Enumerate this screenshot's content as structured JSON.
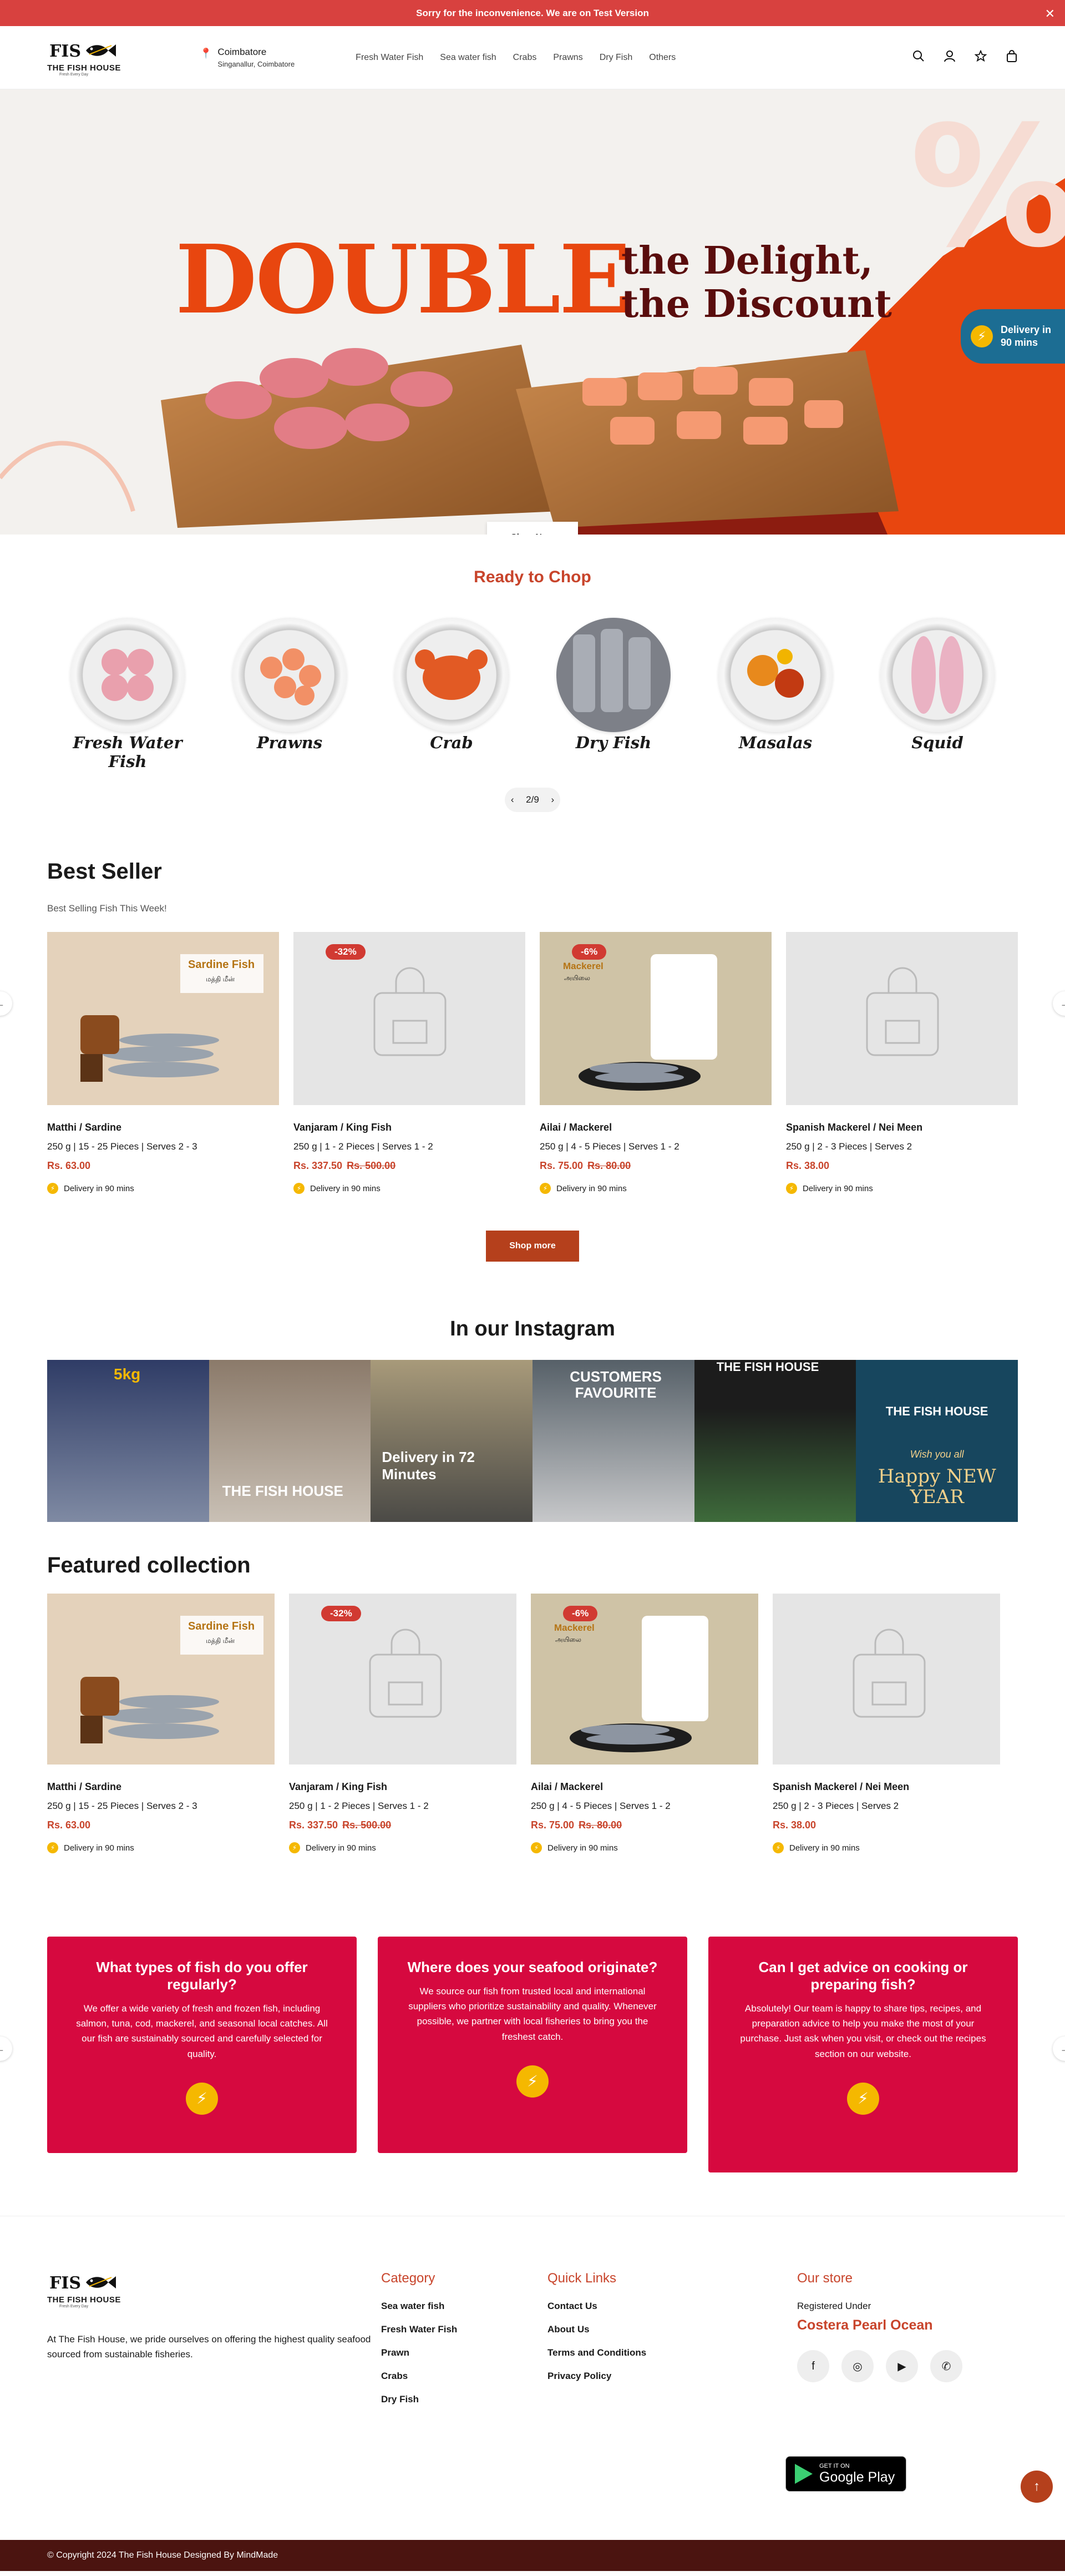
{
  "announcement": {
    "text": "Sorry for the inconvenience. We are on Test Version",
    "close": "✕"
  },
  "header": {
    "logo_brand": "THE FISH HOUSE",
    "logo_tag": "Fresh Every Day",
    "location_city": "Coimbatore",
    "location_area": "Singanallur, Coimbatore",
    "nav": [
      "Fresh Water Fish",
      "Sea water fish",
      "Crabs",
      "Prawns",
      "Dry Fish",
      "Others"
    ]
  },
  "hero": {
    "title": "DOUBLE",
    "subtitle_line1": "the Delight,",
    "subtitle_line2": "the Discount",
    "shop_now": "Shop Now",
    "delivery_line1": "Delivery in",
    "delivery_line2": "90 mins"
  },
  "chop": {
    "title": "Ready to Chop",
    "categories": [
      "Fresh Water Fish",
      "Prawns",
      "Crab",
      "Dry Fish",
      "Masalas",
      "Squid"
    ],
    "pager": "2/9"
  },
  "best_seller": {
    "title": "Best Seller",
    "subtitle": "Best Selling Fish This Week!",
    "shop_more": "Shop more",
    "products": [
      {
        "name": "Matthi / Sardine",
        "meta": "250 g | 15 - 25 Pieces | Serves 2 - 3",
        "price": "Rs. 63.00",
        "old": "",
        "badge": "",
        "img_label": "Sardine Fish",
        "img_label2": "மத்தி மீன்",
        "delivery": "Delivery in 90 mins"
      },
      {
        "name": "Vanjaram / King Fish",
        "meta": "250 g | 1 - 2 Pieces | Serves 1 - 2",
        "price": "Rs. 337.50",
        "old": "Rs. 500.00",
        "badge": "-32%",
        "img_label": "",
        "img_label2": "",
        "delivery": "Delivery in 90 mins"
      },
      {
        "name": "Ailai / Mackerel",
        "meta": "250 g | 4 - 5 Pieces | Serves 1 - 2",
        "price": "Rs. 75.00",
        "old": "Rs. 80.00",
        "badge": "-6%",
        "img_label": "Mackerel",
        "img_label2": "அயிலை",
        "delivery": "Delivery in 90 mins"
      },
      {
        "name": "Spanish Mackerel / Nei Meen",
        "meta": "250 g | 2 - 3 Pieces | Serves 2",
        "price": "Rs. 38.00",
        "old": "",
        "badge": "",
        "img_label": "",
        "img_label2": "",
        "delivery": "Delivery in 90 mins"
      }
    ]
  },
  "instagram": {
    "title": "In our Instagram",
    "tiles": [
      {
        "caption": "5kg"
      },
      {
        "caption": "THE FISH HOUSE"
      },
      {
        "caption": "Delivery in 72 Minutes"
      },
      {
        "caption": "CUSTOMERS FAVOURITE"
      },
      {
        "caption": "THE FISH HOUSE"
      },
      {
        "caption": "THE FISH HOUSE",
        "caption2": "Wish you all",
        "caption3": "Happy NEW YEAR"
      }
    ]
  },
  "featured": {
    "title": "Featured collection",
    "products": [
      {
        "name": "Matthi / Sardine",
        "meta": "250 g | 15 - 25 Pieces | Serves 2 - 3",
        "price": "Rs. 63.00",
        "old": "",
        "badge": "",
        "img_label": "Sardine Fish",
        "img_label2": "மத்தி மீன்",
        "delivery": "Delivery in 90 mins"
      },
      {
        "name": "Vanjaram / King Fish",
        "meta": "250 g | 1 - 2 Pieces | Serves 1 - 2",
        "price": "Rs. 337.50",
        "old": "Rs. 500.00",
        "badge": "-32%",
        "img_label": "",
        "img_label2": "",
        "delivery": "Delivery in 90 mins"
      },
      {
        "name": "Ailai / Mackerel",
        "meta": "250 g | 4 - 5 Pieces | Serves 1 - 2",
        "price": "Rs. 75.00",
        "old": "Rs. 80.00",
        "badge": "-6%",
        "img_label": "Mackerel",
        "img_label2": "அயிலை",
        "delivery": "Delivery in 90 mins"
      },
      {
        "name": "Spanish Mackerel / Nei Meen",
        "meta": "250 g | 2 - 3 Pieces | Serves 2",
        "price": "Rs. 38.00",
        "old": "",
        "badge": "",
        "img_label": "",
        "img_label2": "",
        "delivery": "Delivery in 90 mins"
      }
    ]
  },
  "faq": [
    {
      "q": "What types of fish do you offer regularly?",
      "a": "We offer a wide variety of fresh and frozen fish, including salmon, tuna, cod, mackerel, and seasonal local catches. All our fish are sustainably sourced and carefully selected for quality."
    },
    {
      "q": "Where does your seafood originate?",
      "a": "We source our fish from trusted local and international suppliers who prioritize sustainability and quality. Whenever possible, we partner with local fisheries to bring you the freshest catch."
    },
    {
      "q": "Can I get advice on cooking or preparing fish?",
      "a": "Absolutely! Our team is happy to share tips, recipes, and preparation advice to help you make the most of your purchase. Just ask when you visit, or check out the recipes section on our website."
    }
  ],
  "footer": {
    "about": "At The Fish House, we pride ourselves on offering the highest quality seafood sourced from sustainable fisheries.",
    "category_title": "Category",
    "categories": [
      "Sea water fish",
      "Fresh Water Fish",
      "Prawn",
      "Crabs",
      "Dry Fish"
    ],
    "links_title": "Quick Links",
    "links": [
      "Contact Us",
      "About Us",
      "Terms and Conditions",
      "Privacy Policy"
    ],
    "store_title": "Our store",
    "registered": "Registered Under",
    "company": "Costera Pearl Ocean",
    "gplay_small": "GET IT ON",
    "gplay_big": "Google Play",
    "copyright": "© Copyright 2024 The Fish House Designed By MindMade"
  },
  "colors": {
    "accent": "#c8442b",
    "announce": "#d8413f",
    "faq": "#d6093f",
    "footer_bar": "#4b1410",
    "bolt": "#f5b800"
  }
}
